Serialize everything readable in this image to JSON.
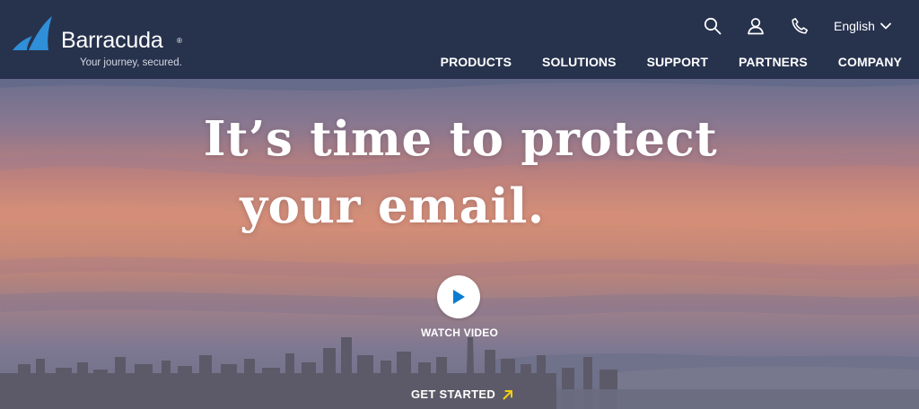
{
  "brand": {
    "name": "Barracuda",
    "registered": "®",
    "tagline": "Your journey, secured.",
    "colors": {
      "header_bg": "#27324d",
      "logo_blue": "#2f8fd8",
      "arrow_yellow": "#f2d00f",
      "play_blue": "#0a7cd1"
    }
  },
  "header": {
    "icons": [
      "search-icon",
      "user-icon",
      "phone-icon",
      "chevron-down-icon"
    ],
    "language": "English",
    "nav": [
      {
        "label": "PRODUCTS"
      },
      {
        "label": "SOLUTIONS"
      },
      {
        "label": "SUPPORT"
      },
      {
        "label": "PARTNERS"
      },
      {
        "label": "COMPANY"
      }
    ]
  },
  "hero": {
    "title_line1": "It’s time to protect",
    "title_line2": "your email.",
    "watch_video_label": "WATCH VIDEO",
    "get_started_label": "GET STARTED"
  }
}
